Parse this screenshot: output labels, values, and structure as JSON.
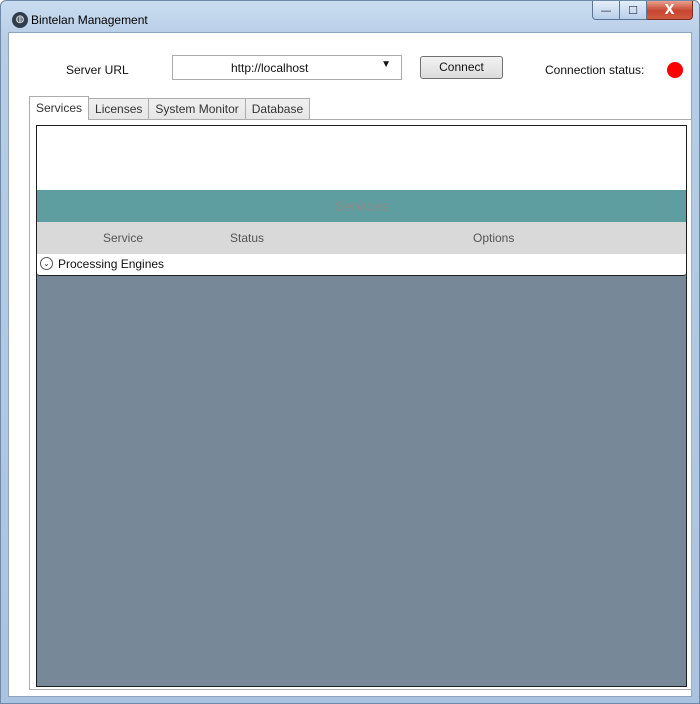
{
  "window": {
    "title": "Bintelan Management",
    "controls": {
      "minimize": "—",
      "maximize": "☐",
      "close": "X"
    }
  },
  "toolbar": {
    "server_url_label": "Server URL",
    "server_url_value": "http://localhost",
    "connect_label": "Connect",
    "connection_status_label": "Connection status:",
    "connection_status_color": "#ff0000"
  },
  "tabs": [
    {
      "label": "Services",
      "active": true
    },
    {
      "label": "Licenses",
      "active": false
    },
    {
      "label": "System Monitor",
      "active": false
    },
    {
      "label": "Database",
      "active": false
    }
  ],
  "services": {
    "header": "Services",
    "columns": [
      "Service",
      "Status",
      "Options"
    ],
    "groups": [
      {
        "label": "Processing Engines",
        "expanded": false
      }
    ]
  },
  "colors": {
    "header_teal": "#5f9ea0",
    "panel_slate": "#778899",
    "column_header_gray": "#d9d9d9"
  },
  "icons": {
    "app": "app-logo-icon",
    "combo_arrow": "chevron-down-icon",
    "expander": "chevron-down-circle-icon"
  }
}
